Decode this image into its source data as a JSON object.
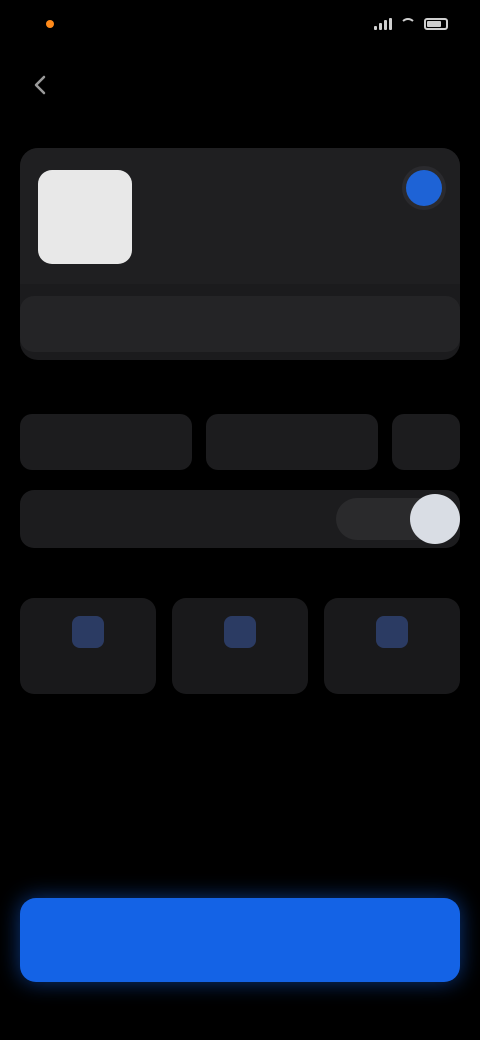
{
  "status_bar": {
    "time": "",
    "icons": [
      "signal-icon",
      "wifi-icon",
      "battery-icon"
    ]
  },
  "header": {
    "title": "",
    "back_icon": "back-arrow-icon"
  },
  "card": {
    "name": "",
    "subtitle": "",
    "selected": true,
    "action_label": ""
  },
  "options": {
    "labels": [
      "",
      "",
      ""
    ],
    "buttons": [
      "",
      "",
      ""
    ]
  },
  "toggle_row": {
    "label": "",
    "on": true
  },
  "section": {
    "label": ""
  },
  "tiles": [
    {
      "label": "",
      "icon": "tile-icon"
    },
    {
      "label": "",
      "icon": "tile-icon"
    },
    {
      "label": "",
      "icon": "tile-icon"
    }
  ],
  "primary_button": {
    "label": ""
  },
  "colors": {
    "background": "#000000",
    "accent": "#1463e6",
    "card": "#1b1b1d",
    "status_dot": "#ff8a1a"
  }
}
